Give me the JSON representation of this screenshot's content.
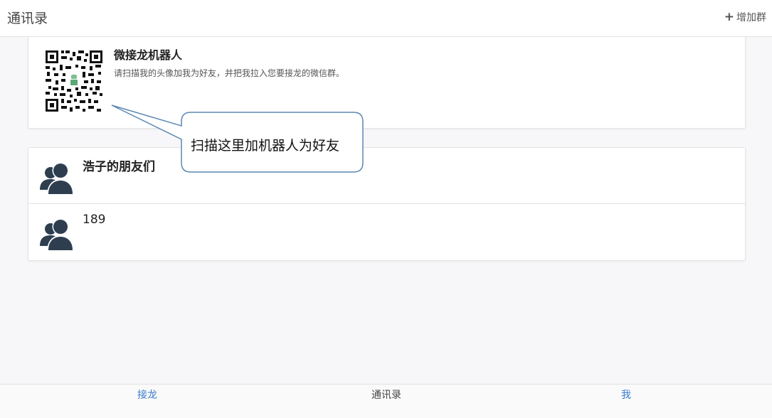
{
  "header": {
    "title": "通讯录",
    "add_group_icon": "plus-icon",
    "add_group_label": "增加群"
  },
  "bot": {
    "name": "微接龙机器人",
    "description": "请扫描我的头像加我为好友，并把我拉入您要接龙的微信群。",
    "qr_icon": "qr-code-icon"
  },
  "groups": [
    {
      "name": "浩子的朋友们",
      "icon": "group-avatar-icon"
    },
    {
      "name": "189",
      "icon": "group-avatar-icon"
    }
  ],
  "callout": {
    "text": "扫描这里加机器人为好友"
  },
  "tabs": [
    {
      "label": "接龙",
      "color": "#3a7cc9"
    },
    {
      "label": "通讯录",
      "color": "#444444"
    },
    {
      "label": "我",
      "color": "#3a7cc9"
    }
  ]
}
